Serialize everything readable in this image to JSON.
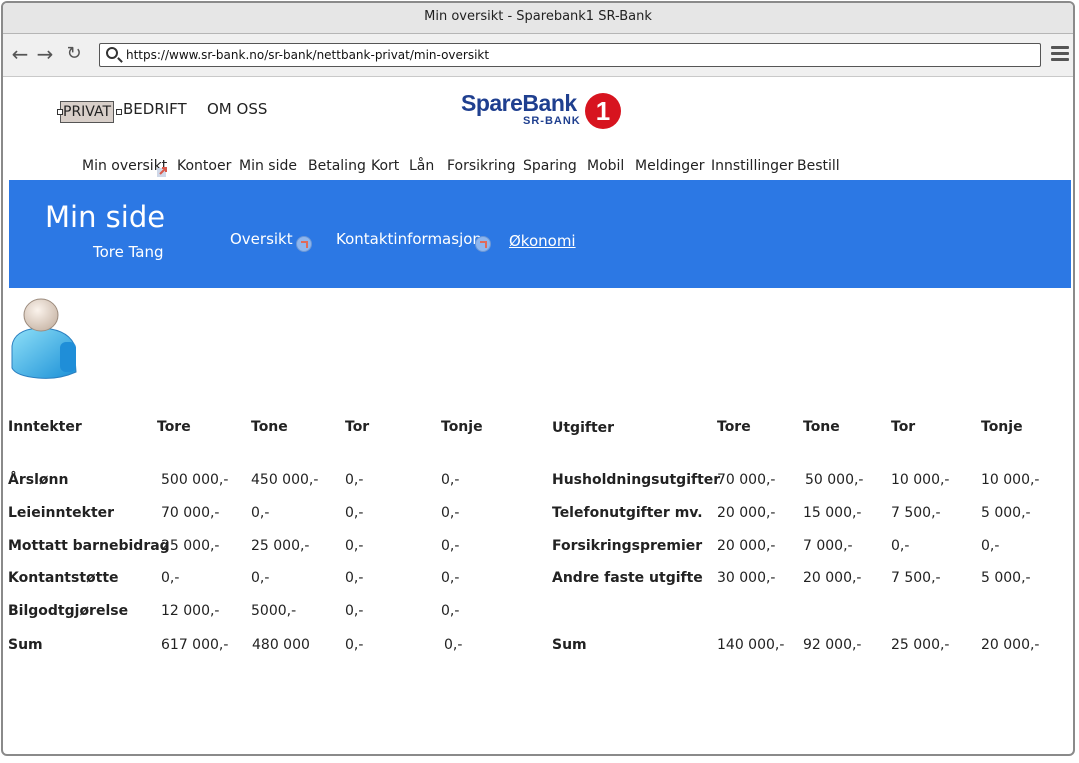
{
  "window": {
    "title": "Min oversikt - Sparebank1 SR-Bank"
  },
  "browser": {
    "url": "https://www.sr-bank.no/sr-bank/nettbank-privat/min-oversikt"
  },
  "topnav": {
    "privat": "PRIVAT",
    "bedrift": "BEDRIFT",
    "om_oss": "OM OSS"
  },
  "logo": {
    "brand": "SpareBank",
    "sub": "SR-BANK",
    "number": "1"
  },
  "mainmenu": [
    "Min oversikt",
    "Kontoer",
    "Min side",
    "Betaling",
    "Kort",
    "Lån",
    "Forsikring",
    "Sparing",
    "Mobil",
    "Meldinger",
    "Innstillinger",
    "Bestill"
  ],
  "banner": {
    "title": "Min side",
    "user": "Tore Tang",
    "links": [
      "Oversikt",
      "Kontaktinformasjon",
      "Økonomi"
    ]
  },
  "income": {
    "columns": [
      "Inntekter",
      "Tore",
      "Tone",
      "Tor",
      "Tonje"
    ],
    "rows": [
      [
        "Årslønn",
        "500 000,-",
        "450 000,-",
        "0,-",
        "0,-"
      ],
      [
        "Leieinntekter",
        "70 000,-",
        "0,-",
        "0,-",
        "0,-"
      ],
      [
        "Mottatt barnebidrag",
        "25 000,-",
        "25 000,-",
        "0,-",
        "0,-"
      ],
      [
        "Kontantstøtte",
        "0,-",
        "0,-",
        "0,-",
        "0,-"
      ],
      [
        "Bilgodtgjørelse",
        "12 000,-",
        "5000,-",
        "0,-",
        "0,-"
      ],
      [
        "Sum",
        "617 000,-",
        "480 000",
        "0,-",
        "0,-"
      ]
    ]
  },
  "expenses": {
    "columns": [
      "Utgifter",
      "Tore",
      "Tone",
      "Tor",
      "Tonje"
    ],
    "rows": [
      [
        "Husholdningsutgifter",
        "70 000,-",
        "50 000,-",
        "10 000,-",
        "10 000,-"
      ],
      [
        "Telefonutgifter mv.",
        "20 000,-",
        "15 000,-",
        "7 500,-",
        "5 000,-"
      ],
      [
        "Forsikringspremier",
        "20 000,-",
        "7 000,-",
        "0,-",
        "0,-"
      ],
      [
        "Andre faste utgifte",
        "30 000,-",
        "20 000,-",
        "7 500,-",
        "5 000,-"
      ],
      [
        "Sum",
        "140 000,-",
        "92 000,-",
        "25 000,-",
        "20 000,-"
      ]
    ]
  },
  "colors": {
    "banner": "#2c78e4",
    "logo_blue": "#1f3f8f",
    "logo_red": "#d7141f"
  }
}
